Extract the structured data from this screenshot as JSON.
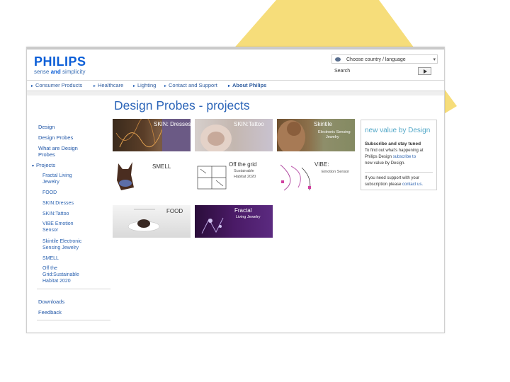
{
  "brand": {
    "logo": "PHILIPS",
    "tagline_prefix": "sense ",
    "tagline_and": "and",
    "tagline_suffix": " simplicity",
    "color": "#0b5ed7"
  },
  "header": {
    "country_select": "Choose country / language",
    "search_label": "Search",
    "search_value": ""
  },
  "nav": {
    "items": [
      "Consumer Products",
      "Healthcare",
      "Lighting",
      "Contact and Support",
      "About Philips"
    ]
  },
  "page": {
    "title": "Design Probes - projects"
  },
  "sidebar": {
    "design": "Design",
    "design_probes": "Design Probes",
    "what_line1": "What are Design",
    "what_line2": "Probes",
    "projects": "Projects",
    "sub_items": [
      {
        "l1": "Fractal Living",
        "l2": "Jewelry"
      },
      {
        "l1": "FOOD",
        "l2": ""
      },
      {
        "l1": "SKIN:Dresses",
        "l2": ""
      },
      {
        "l1": "SKIN:Tattoo",
        "l2": ""
      },
      {
        "l1": "VIBE Emotion",
        "l2": "Sensor"
      },
      {
        "l1": "Skintile Electronic",
        "l2": "Sensing Jewelry"
      },
      {
        "l1": "SMELL",
        "l2": ""
      },
      {
        "l1": "Off the",
        "l2": "Grid:Sustainable"
      },
      {
        "l1": "Habitat 2020",
        "l2": ""
      }
    ],
    "downloads": "Downloads",
    "feedback": "Feedback"
  },
  "tiles": [
    {
      "name": "SKIN: Dresses",
      "sub1": "",
      "sub2": ""
    },
    {
      "name": "SKIN:Tattoo",
      "sub1": "",
      "sub2": ""
    },
    {
      "name": "Skintile",
      "sub1": "Electronic Sensing",
      "sub2": "Jewelry"
    },
    {
      "name": "SMELL",
      "sub1": "",
      "sub2": ""
    },
    {
      "name": "Off the grid",
      "sub1": "Sustainable",
      "sub2": "Habitat 2020"
    },
    {
      "name": "VIBE:",
      "sub1": "Emotion Sensor",
      "sub2": ""
    },
    {
      "name": "FOOD",
      "sub1": "",
      "sub2": ""
    },
    {
      "name": "Fractal",
      "sub1": "Living Jewelry",
      "sub2": ""
    }
  ],
  "rightbox": {
    "title": "new value by Design",
    "subscribe_heading": "Subscribe and stay tuned",
    "text1": "To find out what's happening at",
    "text2a": "Philips Design ",
    "text2_link": "subscribe to",
    "text3": "new value by Design.",
    "support1": "If you need support with your",
    "support2a": "subscription please ",
    "support2_link": "contact us."
  },
  "colors": {
    "link": "#1f55a6",
    "title": "#2c65b8",
    "accent_shape": "#f6d76b"
  }
}
